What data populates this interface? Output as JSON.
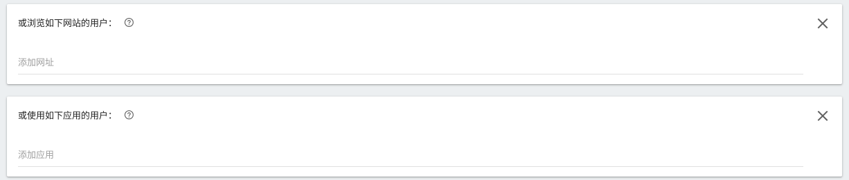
{
  "sections": [
    {
      "title": "或浏览如下网站的用户：",
      "help_icon": "help-circle-icon",
      "close_icon": "close-icon",
      "input": {
        "value": "",
        "placeholder": "添加网址"
      }
    },
    {
      "title": "或使用如下应用的用户：",
      "help_icon": "help-circle-icon",
      "close_icon": "close-icon",
      "input": {
        "value": "",
        "placeholder": "添加应用"
      }
    }
  ],
  "colors": {
    "background": "#eceff1",
    "card": "#ffffff",
    "text": "#212121",
    "placeholder": "#9e9e9e",
    "icon": "#616161",
    "divider": "#e0e0e0"
  }
}
